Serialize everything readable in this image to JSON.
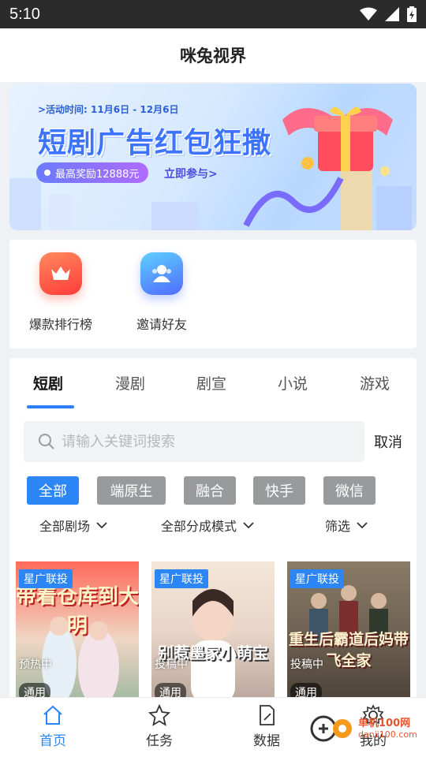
{
  "status_bar": {
    "time": "5:10"
  },
  "app": {
    "title": "咪兔视界"
  },
  "banner": {
    "activity_time": ">活动时间: 11月6日 - 12月6日",
    "headline": "短剧广告红包狂撒",
    "reward_pill": "最高奖励12888元",
    "join_label": "立即参与>"
  },
  "shortcuts": [
    {
      "label": "爆款排行榜",
      "icon": "crown-icon",
      "color": "#ff5a3c"
    },
    {
      "label": "邀请好友",
      "icon": "users-icon",
      "color": "#4f7cff"
    }
  ],
  "tabs": [
    {
      "label": "短剧",
      "active": true
    },
    {
      "label": "漫剧"
    },
    {
      "label": "剧宣"
    },
    {
      "label": "小说"
    },
    {
      "label": "游戏"
    }
  ],
  "search": {
    "placeholder": "请输入关键词搜索",
    "cancel_label": "取消"
  },
  "chips": [
    {
      "label": "全部",
      "active": true
    },
    {
      "label": "端原生"
    },
    {
      "label": "融合"
    },
    {
      "label": "快手"
    },
    {
      "label": "微信"
    }
  ],
  "filters": [
    {
      "label": "全部剧场"
    },
    {
      "label": "全部分成模式"
    },
    {
      "label": "筛选"
    }
  ],
  "cards": [
    {
      "tag": "星广联投",
      "state": "预热中",
      "kind": "通用",
      "poster_title": "带着仓库到大明"
    },
    {
      "tag": "星广联投",
      "state": "投稿中",
      "kind": "通用",
      "poster_title": "别惹墨家小萌宝"
    },
    {
      "tag": "星广联投",
      "state": "投稿中",
      "kind": "通用",
      "poster_title": "重生后霸道后妈带飞全家"
    }
  ],
  "bottom_nav": [
    {
      "label": "首页",
      "icon": "home-icon",
      "active": true
    },
    {
      "label": "任务",
      "icon": "star-icon"
    },
    {
      "label": "数据",
      "icon": "data-icon"
    },
    {
      "label": "我的",
      "icon": "gear-icon"
    }
  ],
  "watermark": {
    "line1": "单机100网",
    "line2": "danji100.com"
  },
  "colors": {
    "accent": "#2d86f6",
    "chip_inactive": "#999a9c"
  }
}
